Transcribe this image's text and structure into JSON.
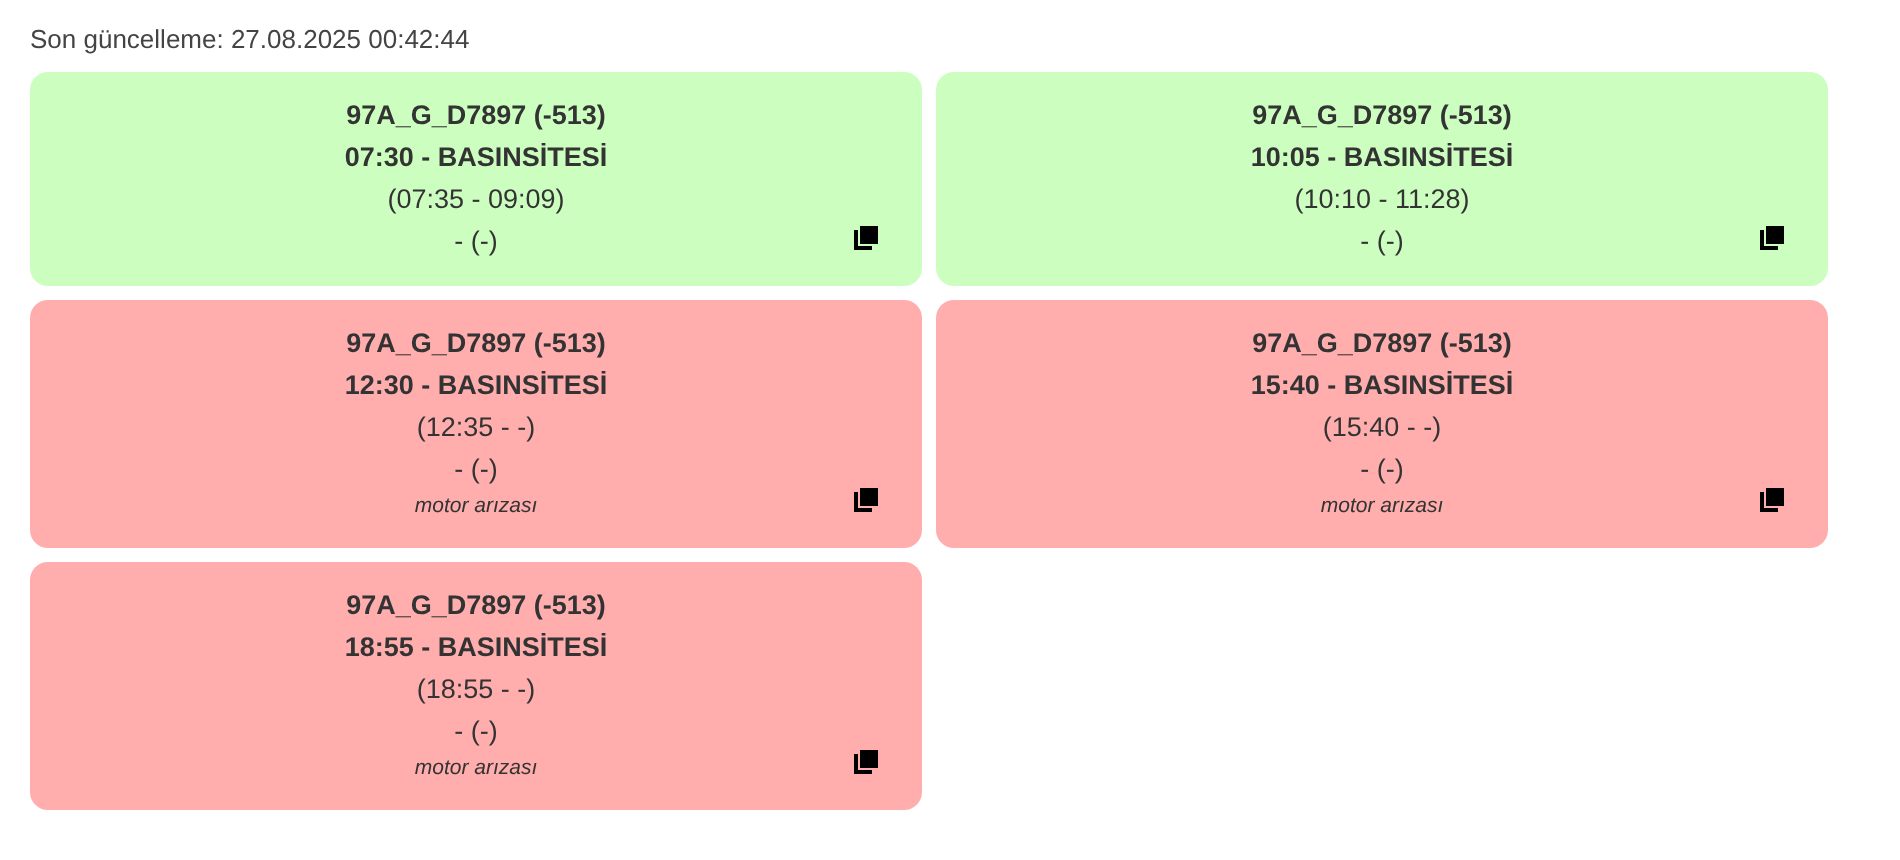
{
  "last_update": "Son güncelleme: 27.08.2025 00:42:44",
  "cards": [
    {
      "color": "#ccffbf",
      "vehicle": "97A_G_D7897 (-513)",
      "trip": "07:30 - BASINSİTESİ",
      "actual": "(07:35 - 09:09)",
      "driver": "- (-)"
    },
    {
      "color": "#ccffbf",
      "vehicle": "97A_G_D7897 (-513)",
      "trip": "10:05 - BASINSİTESİ",
      "actual": "(10:10 - 11:28)",
      "driver": "- (-)"
    },
    {
      "color": "#ffadad",
      "vehicle": "97A_G_D7897 (-513)",
      "trip": "12:30 - BASINSİTESİ",
      "actual": "(12:35 - -)",
      "driver": "- (-)",
      "note": "motor arızası"
    },
    {
      "color": "#ffadad",
      "vehicle": "97A_G_D7897 (-513)",
      "trip": "15:40 - BASINSİTESİ",
      "actual": "(15:40 - -)",
      "driver": "- (-)",
      "note": "motor arızası"
    },
    {
      "color": "#ffadad",
      "vehicle": "97A_G_D7897 (-513)",
      "trip": "18:55 - BASINSİTESİ",
      "actual": "(18:55 - -)",
      "driver": "- (-)",
      "note": "motor arızası"
    }
  ]
}
